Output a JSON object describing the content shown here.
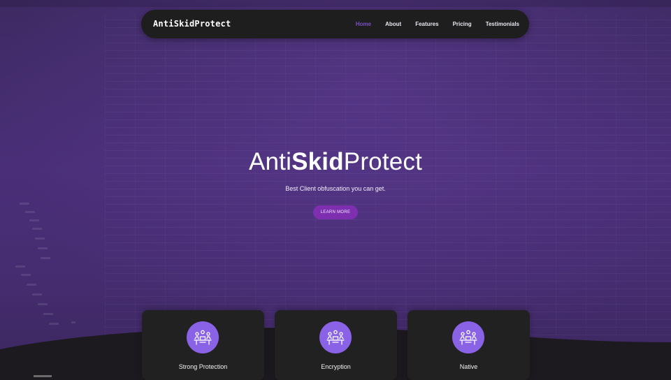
{
  "navbar": {
    "brand": "AntiSkidProtect",
    "links": [
      {
        "label": "Home",
        "active": true
      },
      {
        "label": "About",
        "active": false
      },
      {
        "label": "Features",
        "active": false
      },
      {
        "label": "Pricing",
        "active": false
      },
      {
        "label": "Testimonials",
        "active": false
      }
    ]
  },
  "hero": {
    "title_part1": "Anti",
    "title_part2": "Skid",
    "title_part3": "Protect",
    "subtitle": "Best Client obfuscation you can get.",
    "cta_label": "LEARN MORE"
  },
  "features": [
    {
      "title": "Strong Protection",
      "icon": "team-meeting-icon"
    },
    {
      "title": "Encryption",
      "icon": "team-meeting-icon"
    },
    {
      "title": "Native",
      "icon": "team-meeting-icon"
    }
  ],
  "colors": {
    "accent": "#7a4fc2",
    "button": "#7d2fb0",
    "icon_circle": "#8a62e6",
    "card": "#222122",
    "navbar": "#1e1e1f"
  }
}
